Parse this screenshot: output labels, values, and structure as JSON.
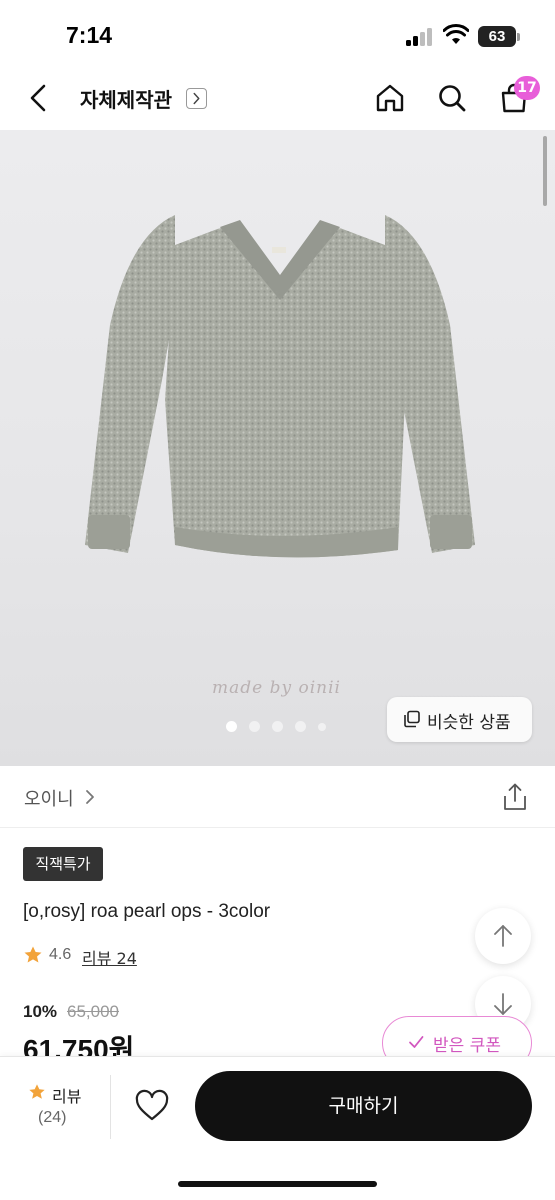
{
  "status_bar": {
    "time": "7:14",
    "battery": "63"
  },
  "nav": {
    "title": "자체제작관",
    "cart_count": "17"
  },
  "hero": {
    "watermark": "made by oinii",
    "carousel_dots": 5,
    "active_index": 0,
    "similar_button_label": "비슷한 상품"
  },
  "brand": {
    "name": "오이니"
  },
  "product": {
    "badge": "직잭특가",
    "title": "[o,rosy] roa pearl ops - 3color",
    "rating": "4.6",
    "review_link": "리뷰 24",
    "discount_pct": "10%",
    "original_price": "65,000",
    "final_price": "61,750원"
  },
  "coupon": {
    "label": "받은 쿠폰"
  },
  "bottom_bar": {
    "review_label": "리뷰",
    "review_count": "(24)",
    "buy_label": "구매하기"
  },
  "colors": {
    "accent_pink": "#e85ed9",
    "star": "#f2a33a",
    "buy_button": "#111111"
  }
}
